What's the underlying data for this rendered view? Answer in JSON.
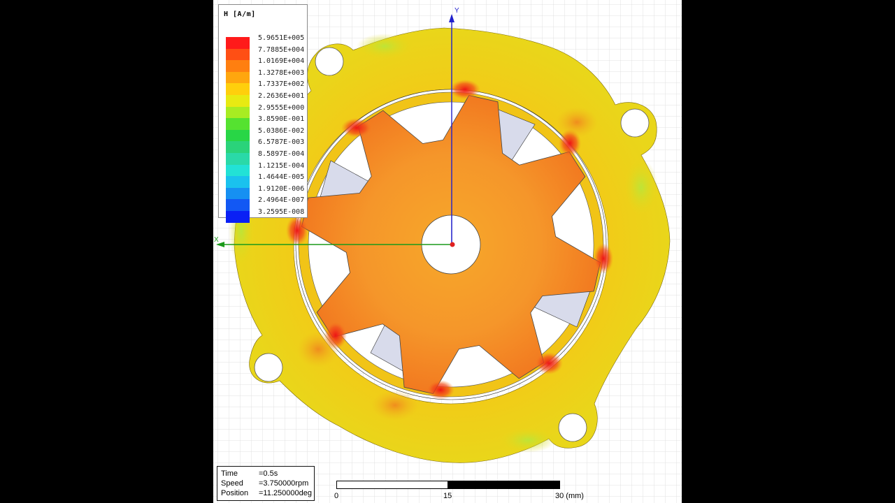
{
  "legend": {
    "title": "H [A/m]",
    "levels": [
      {
        "label": "5.9651E+005",
        "color": "#ff1a1a"
      },
      {
        "label": "7.7885E+004",
        "color": "#ff4f14"
      },
      {
        "label": "1.0169E+004",
        "color": "#ff7f10"
      },
      {
        "label": "1.3278E+003",
        "color": "#ffa60e"
      },
      {
        "label": "1.7337E+002",
        "color": "#ffcf0c"
      },
      {
        "label": "2.2636E+001",
        "color": "#e8ea12"
      },
      {
        "label": "2.9555E+000",
        "color": "#a8ec22"
      },
      {
        "label": "3.8590E-001",
        "color": "#55e230"
      },
      {
        "label": "5.0386E-002",
        "color": "#28d646"
      },
      {
        "label": "6.5787E-003",
        "color": "#2ad37a"
      },
      {
        "label": "8.5897E-004",
        "color": "#2ad9a8"
      },
      {
        "label": "1.1215E-004",
        "color": "#22e2d6"
      },
      {
        "label": "1.4644E-005",
        "color": "#1ac2ee"
      },
      {
        "label": "1.9120E-006",
        "color": "#1690f2"
      },
      {
        "label": "2.4964E-007",
        "color": "#1258f4"
      },
      {
        "label": "3.2595E-008",
        "color": "#0a20f5"
      }
    ]
  },
  "axes": {
    "x_label": "X",
    "y_label": "Y"
  },
  "sim": {
    "time_key": "Time",
    "time_val": "=0.5s",
    "speed_key": "Speed",
    "speed_val": "=3.750000rpm",
    "position_key": "Position",
    "position_val": "=11.250000deg"
  },
  "scale": {
    "tick0": "0",
    "tick1": "15",
    "tick2": "30 (mm)"
  },
  "colors": {
    "stator": "#f0cf12",
    "rotor": "#f5a020",
    "gap_fill": "#d8dbeb",
    "grid": "#e2e2e2",
    "hotspot": "#ef1d1d",
    "axis_x": "#1a9a1a",
    "axis_y": "#2020cc"
  }
}
